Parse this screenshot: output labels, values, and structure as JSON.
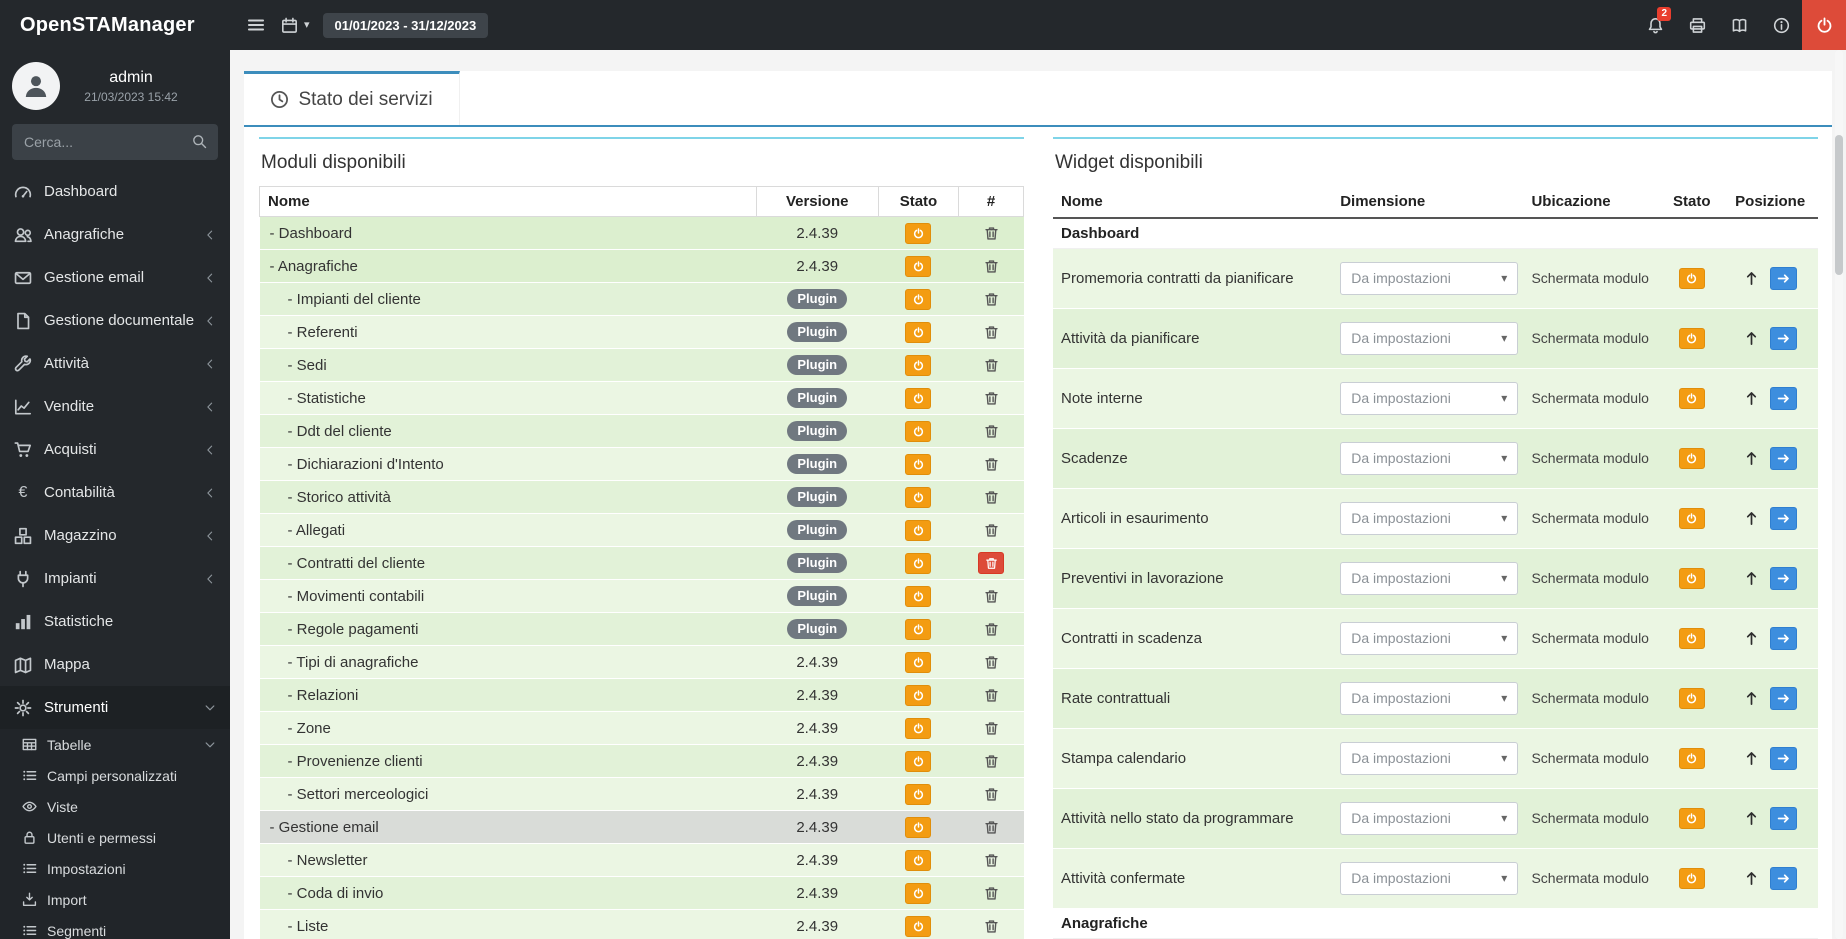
{
  "colors": {
    "dark": "#24282c",
    "accent": "#3c8dbc",
    "cyan": "#7fd4e8",
    "warning": "#f39c12",
    "danger": "#dd4b39",
    "primary": "#3d8ede",
    "green-a": "#ebf6e3",
    "green-b": "#e2f2d8",
    "green-module": "#dcefcf",
    "gray-row": "#d9dcd8"
  },
  "header": {
    "app_title": "OpenSTAManager",
    "date_range": "01/01/2023 - 31/12/2023",
    "notification_count": "2"
  },
  "user": {
    "name": "admin",
    "datetime": "21/03/2023 15:42"
  },
  "search": {
    "placeholder": "Cerca..."
  },
  "sidebar": {
    "items": [
      {
        "label": "Dashboard",
        "icon": "gauge"
      },
      {
        "label": "Anagrafiche",
        "icon": "users",
        "chevron": "left"
      },
      {
        "label": "Gestione email",
        "icon": "envelope",
        "chevron": "left"
      },
      {
        "label": "Gestione documentale",
        "icon": "file",
        "chevron": "left"
      },
      {
        "label": "Attività",
        "icon": "wrench",
        "chevron": "left"
      },
      {
        "label": "Vendite",
        "icon": "chart-line",
        "chevron": "left"
      },
      {
        "label": "Acquisti",
        "icon": "cart",
        "chevron": "left"
      },
      {
        "label": "Contabilità",
        "icon": "euro",
        "chevron": "left"
      },
      {
        "label": "Magazzino",
        "icon": "cubes",
        "chevron": "left"
      },
      {
        "label": "Impianti",
        "icon": "plug",
        "chevron": "left"
      },
      {
        "label": "Statistiche",
        "icon": "bar-chart"
      },
      {
        "label": "Mappa",
        "icon": "map"
      },
      {
        "label": "Strumenti",
        "icon": "gear",
        "chevron": "down",
        "active": true
      }
    ],
    "subitems": [
      {
        "label": "Tabelle",
        "icon": "table",
        "chevron": "down"
      },
      {
        "label": "Campi personalizzati",
        "icon": "list"
      },
      {
        "label": "Viste",
        "icon": "eye"
      },
      {
        "label": "Utenti e permessi",
        "icon": "lock"
      },
      {
        "label": "Impostazioni",
        "icon": "list"
      },
      {
        "label": "Import",
        "icon": "import"
      },
      {
        "label": "Segmenti",
        "icon": "list"
      }
    ]
  },
  "tabs": {
    "active_label": "Stato dei servizi"
  },
  "modules": {
    "title": "Moduli disponibili",
    "headers": [
      "Nome",
      "Versione",
      "Stato",
      "#"
    ],
    "plugin_label": "Plugin",
    "rows": [
      {
        "label": "- Dashboard",
        "version": "2.4.39",
        "level": 0,
        "variant": "module"
      },
      {
        "label": "- Anagrafiche",
        "version": "2.4.39",
        "level": 0,
        "variant": "module"
      },
      {
        "label": "- Impianti del cliente",
        "plugin": true,
        "level": 1
      },
      {
        "label": "- Referenti",
        "plugin": true,
        "level": 1
      },
      {
        "label": "- Sedi",
        "plugin": true,
        "level": 1
      },
      {
        "label": "- Statistiche",
        "plugin": true,
        "level": 1
      },
      {
        "label": "- Ddt del cliente",
        "plugin": true,
        "level": 1
      },
      {
        "label": "- Dichiarazioni d'Intento",
        "plugin": true,
        "level": 1
      },
      {
        "label": "- Storico attività",
        "plugin": true,
        "level": 1
      },
      {
        "label": "- Allegati",
        "plugin": true,
        "level": 1
      },
      {
        "label": "- Contratti del cliente",
        "plugin": true,
        "level": 1,
        "danger": true
      },
      {
        "label": "- Movimenti contabili",
        "plugin": true,
        "level": 1
      },
      {
        "label": "- Regole pagamenti",
        "plugin": true,
        "level": 1
      },
      {
        "label": "- Tipi di anagrafiche",
        "version": "2.4.39",
        "level": 1
      },
      {
        "label": "- Relazioni",
        "version": "2.4.39",
        "level": 1
      },
      {
        "label": "- Zone",
        "version": "2.4.39",
        "level": 1
      },
      {
        "label": "- Provenienze clienti",
        "version": "2.4.39",
        "level": 1
      },
      {
        "label": "- Settori merceologici",
        "version": "2.4.39",
        "level": 1
      },
      {
        "label": "- Gestione email",
        "version": "2.4.39",
        "level": 0,
        "variant": "gray"
      },
      {
        "label": "- Newsletter",
        "version": "2.4.39",
        "level": 1
      },
      {
        "label": "- Coda di invio",
        "version": "2.4.39",
        "level": 1
      },
      {
        "label": "- Liste",
        "version": "2.4.39",
        "level": 1
      }
    ]
  },
  "widgets": {
    "title": "Widget disponibili",
    "headers": [
      "Nome",
      "Dimensione",
      "Ubicazione",
      "Stato",
      "Posizione"
    ],
    "sections": [
      {
        "title": "Dashboard",
        "rows": [
          {
            "name": "Promemoria contratti da pianificare",
            "dimension": "Da impostazioni",
            "location": "Schermata modulo"
          },
          {
            "name": "Attività da pianificare",
            "dimension": "Da impostazioni",
            "location": "Schermata modulo"
          },
          {
            "name": "Note interne",
            "dimension": "Da impostazioni",
            "location": "Schermata modulo"
          },
          {
            "name": "Scadenze",
            "dimension": "Da impostazioni",
            "location": "Schermata modulo"
          },
          {
            "name": "Articoli in esaurimento",
            "dimension": "Da impostazioni",
            "location": "Schermata modulo"
          },
          {
            "name": "Preventivi in lavorazione",
            "dimension": "Da impostazioni",
            "location": "Schermata modulo"
          },
          {
            "name": "Contratti in scadenza",
            "dimension": "Da impostazioni",
            "location": "Schermata modulo"
          },
          {
            "name": "Rate contrattuali",
            "dimension": "Da impostazioni",
            "location": "Schermata modulo"
          },
          {
            "name": "Stampa calendario",
            "dimension": "Da impostazioni",
            "location": "Schermata modulo"
          },
          {
            "name": "Attività nello stato da programmare",
            "dimension": "Da impostazioni",
            "location": "Schermata modulo"
          },
          {
            "name": "Attività confermate",
            "dimension": "Da impostazioni",
            "location": "Schermata modulo"
          }
        ]
      },
      {
        "title": "Anagrafiche",
        "rows": []
      }
    ]
  }
}
